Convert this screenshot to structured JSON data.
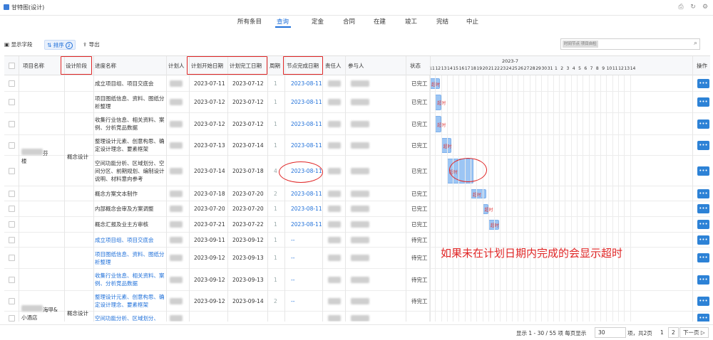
{
  "window": {
    "title": "甘特图(设计)"
  },
  "tabs": [
    "所有条目",
    "查询",
    "定金",
    "合同",
    "在建",
    "竣工",
    "完结",
    "中止"
  ],
  "toolbar": {
    "display_fields": "显示字段",
    "sort": "排序",
    "sort_count": "2",
    "export": "导出"
  },
  "search": {
    "chip": "时间节点 项目自检",
    "placeholder": ""
  },
  "columns": {
    "project": "项目名称",
    "stage": "设计阶段",
    "task": "进度名称",
    "planner": "计划人",
    "plan_start": "计划开始日期",
    "plan_end": "计划完工日期",
    "period": "周期",
    "node_date": "节点完成日期",
    "owner": "责任人",
    "participants": "参与人",
    "status": "状态",
    "ops": "操作"
  },
  "gantt": {
    "month": "2023-7",
    "days": [
      "11",
      "12",
      "13",
      "14",
      "15",
      "16",
      "17",
      "18",
      "19",
      "20",
      "21",
      "22",
      "23",
      "24",
      "25",
      "26",
      "27",
      "28",
      "29",
      "30",
      "31",
      "1",
      "2",
      "3",
      "4",
      "5",
      "6",
      "7",
      "8",
      "9",
      "10",
      "11",
      "12",
      "13",
      "14"
    ]
  },
  "group1": {
    "project_suffix": "芬",
    "project_tail": "楼",
    "stage": "概念设计"
  },
  "group2": {
    "project_suffix": "海甲&",
    "project_tail": "小酒店",
    "stage": "概念设计"
  },
  "rows": [
    {
      "task": "成立项目组、项目交底会",
      "start": "2023-07-11",
      "end": "2023-07-12",
      "period": "1",
      "node": "2023-08-11",
      "status": "已完工",
      "gantt_label": "超时"
    },
    {
      "task": "项目图纸信息、资料、图纸分析整理",
      "start": "2023-07-12",
      "end": "2023-07-12",
      "period": "1",
      "node": "2023-08-11",
      "status": "已完工",
      "gantt_label": "超时"
    },
    {
      "task": "收集行业信息、相关资料、案例、分析竞品数据",
      "start": "2023-07-12",
      "end": "2023-07-12",
      "period": "1",
      "node": "2023-08-11",
      "status": "已完工",
      "gantt_label": "超时"
    },
    {
      "task": "整理设计元素、创意构思、确定设计理念、要素框架",
      "start": "2023-07-13",
      "end": "2023-07-14",
      "period": "1",
      "node": "2023-08-11",
      "status": "已完工",
      "gantt_label": "超时"
    },
    {
      "task": "空间功能分析、区域划分、空间分区、前期规划、编制设计说明、材料意向参考",
      "start": "2023-07-14",
      "end": "2023-07-18",
      "period": "4",
      "node": "2023-08-11",
      "status": "已完工",
      "gantt_label": "超时"
    },
    {
      "task": "概念方案文本制作",
      "start": "2023-07-18",
      "end": "2023-07-20",
      "period": "2",
      "node": "2023-08-11",
      "status": "已完工",
      "gantt_label": "超时"
    },
    {
      "task": "内部概念会审及方案调整",
      "start": "2023-07-20",
      "end": "2023-07-20",
      "period": "1",
      "node": "2023-08-11",
      "status": "已完工",
      "gantt_label": "超时"
    },
    {
      "task": "概念汇报及业主方审核",
      "start": "2023-07-21",
      "end": "2023-07-22",
      "period": "1",
      "node": "2023-08-11",
      "status": "已完工",
      "gantt_label": "超时"
    },
    {
      "task": "成立项目组、项目交底会",
      "start": "2023-09-11",
      "end": "2023-09-12",
      "period": "1",
      "node": "--",
      "status": "待完工"
    },
    {
      "task": "项目图纸信息、资料、图纸分析整理",
      "start": "2023-09-12",
      "end": "2023-09-13",
      "period": "1",
      "node": "--",
      "status": "待完工"
    },
    {
      "task": "收集行业信息、相关资料、案例、分析竞品数据",
      "start": "2023-09-12",
      "end": "2023-09-13",
      "period": "1",
      "node": "--",
      "status": "待完工"
    },
    {
      "task": "整理设计元素、创意构思、确定设计理念、要素框架",
      "start": "2023-09-12",
      "end": "2023-09-14",
      "period": "2",
      "node": "--",
      "status": "待完工"
    },
    {
      "task": "空间功能分析、区域划分、",
      "start": "",
      "end": "",
      "period": "",
      "node": "",
      "status": ""
    }
  ],
  "annotation": "如果未在计划日期内完成的会显示超时",
  "footer": {
    "summary": "显示 1 - 30 / 55 项  每页显示",
    "page_size": "30",
    "per_page_tail": "项，共2页",
    "page1": "1",
    "page2": "2",
    "next": "下一页 ▷"
  },
  "colors": {
    "accent": "#1e6fd9",
    "bar": "#9cc5f4",
    "overdue": "#e23c3c",
    "annotation": "#e02626"
  }
}
